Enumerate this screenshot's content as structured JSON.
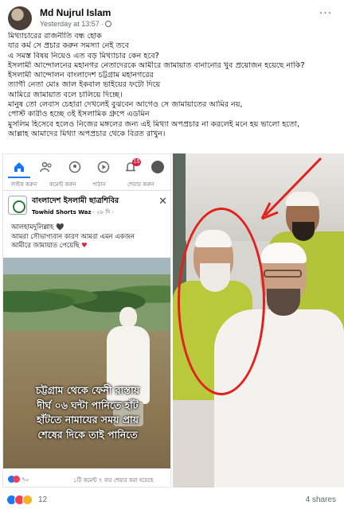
{
  "post": {
    "author": "Md Nujrul Islam",
    "time": "Yesterday at 13:57 ·",
    "more_label": "···",
    "caption_lines": [
      "মিথ্যাচারের রাজনীতি বন্ধ হোক",
      "যার কর্ম সে প্রচার করুন সমস্যা নেই তবে",
      "এ সমস্ত বিষয় নিয়েও এত বড় মিথ্যাচার কেন হবে?",
      "ইসলামী আন্দোলনের মহানগর নেতাদেরকে আমীরে জামায়াত বানানোর খুব প্রয়োজন হয়েছে নাকি?",
      "ইসলামী আন্দোলন বাংলাদেশ চট্টগ্রাম মহানগরের",
      "ত্যাগী নেতা মোঃ জাল ইকবাল ভাইয়ের ফটো দিয়ে",
      "আমিরে জামায়াত বলে চালিয়ে দিচ্ছে।",
      "মানুষ তো লেবাস চেহারা দেখলেই বুঝবেন আগেও সে জামায়াতের আমির নয়,",
      "পোস্ট কারীও হচ্ছে ৩ই ইসলামিক গ্রুপে এডমিন",
      "মুসলিম হিসেবে হলেও নিজের মঙ্গলের জন্য এই মিথ্যা অপপ্রচার না করলেই মনে হয় ভালো হতো,",
      "আল্লাহ আমাদের মিথ্যা অপপ্রচার থেকে বিরত রাখুন।"
    ]
  },
  "screenshot": {
    "nav_icons": [
      "home-icon",
      "friends-icon",
      "groups-icon",
      "watch-icon",
      "bell-icon",
      "profile-icon"
    ],
    "notif_badge": "15",
    "actions": [
      "লাইক করুন",
      "কমেন্ট করুন",
      "পাঠান",
      "শেয়ার করুন"
    ],
    "group_name": "বাংলাদেশ ইসলামী ছাত্রশিবির",
    "group_sub_author": "Towhid Shorts Waz",
    "group_sub_time": " · ২৮ দি · ",
    "close_label": "✕",
    "body_lines": [
      "আলহামদুলিল্লাহ 🖤",
      "আমরা সৌভাগ্যবান কারণ আমরা এমন একজন",
      "আমীরে জামায়াত পেয়েছি "
    ],
    "heart": "♥",
    "overlay_lines": [
      "চট্টগ্রাম থেকে ফেনী রাস্তায়",
      "দীর্ঘ ০৬ ঘন্টা পানিতে হাঁট",
      "হাঁটতে নামাযের সময় প্রায়",
      "শেষের দিকে তাই পানিতে"
    ],
    "reaction_count": "৭০",
    "footer_meta": "১টি কমেন্ট  ৭ বার শেয়ার করা হয়েছে"
  },
  "footer": {
    "reaction_count": "12",
    "shares": "4 shares"
  },
  "colors": {
    "brand_blue": "#1877f2",
    "love_red": "#f33e58",
    "wow_yellow": "#f7b125",
    "highlight_red": "#e3201b"
  }
}
